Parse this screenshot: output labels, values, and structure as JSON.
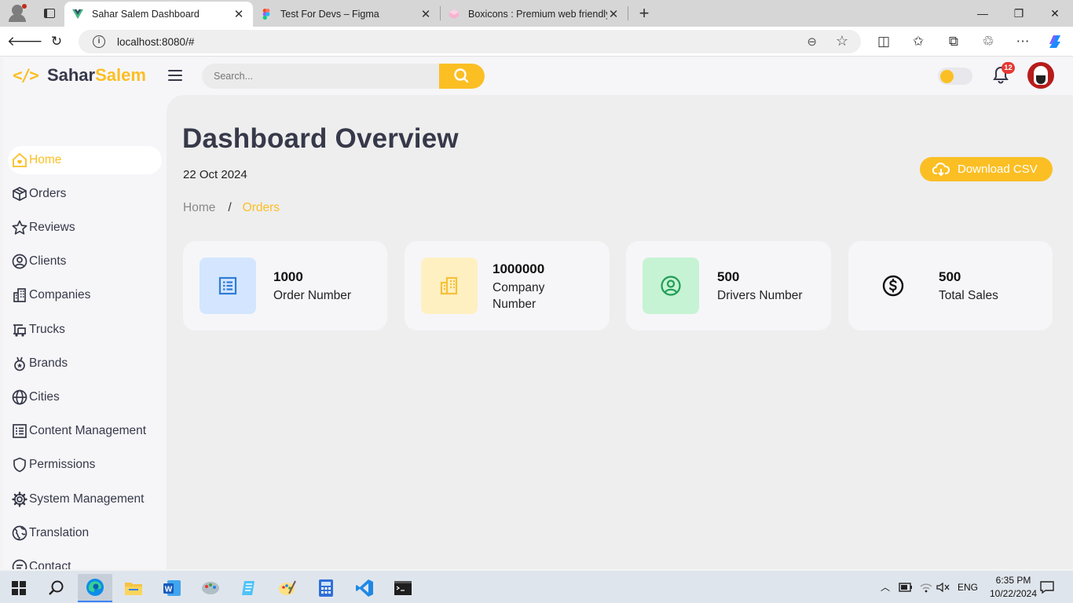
{
  "browser": {
    "tabs": [
      {
        "title": "Sahar Salem Dashboard",
        "active": true,
        "favicon": "vuejs-icon"
      },
      {
        "title": "Test For Devs – Figma",
        "active": false,
        "favicon": "figma-icon"
      },
      {
        "title": "Boxicons : Premium web friendly i",
        "active": false,
        "favicon": "boxicons-icon"
      }
    ],
    "url": "localhost:8080/#"
  },
  "header": {
    "logo_code": "</>",
    "logo_part1": "Sahar",
    "logo_part2": "Salem",
    "search_placeholder": "Search...",
    "notification_count": "12",
    "accent": "#fbbf24"
  },
  "sidebar": {
    "items": [
      {
        "label": "Home",
        "icon": "home-icon",
        "active": true
      },
      {
        "label": "Orders",
        "icon": "package-icon"
      },
      {
        "label": "Reviews",
        "icon": "star-icon"
      },
      {
        "label": "Clients",
        "icon": "user-circle-icon"
      },
      {
        "label": "Companies",
        "icon": "buildings-icon"
      },
      {
        "label": "Trucks",
        "icon": "truck-icon"
      },
      {
        "label": "Brands",
        "icon": "medal-icon"
      },
      {
        "label": "Cities",
        "icon": "globe-icon"
      },
      {
        "label": "Content Management",
        "icon": "list-icon"
      },
      {
        "label": "Permissions",
        "icon": "shield-icon"
      },
      {
        "label": "System Management",
        "icon": "gear-icon"
      },
      {
        "label": "Translation",
        "icon": "world-icon"
      },
      {
        "label": "Contact",
        "icon": "message-icon"
      }
    ]
  },
  "main": {
    "title": "Dashboard Overview",
    "date": "22 Oct 2024",
    "breadcrumb": {
      "home": "Home",
      "separator": "/",
      "current": "Orders"
    },
    "download_label": "Download CSV",
    "cards": [
      {
        "value": "1000",
        "label": "Order Number",
        "icon": "receipt-icon",
        "bg": "#d4e6ff",
        "fg": "#2e7bd6"
      },
      {
        "value": "1000000",
        "label": "Company Number",
        "icon": "buildings-icon",
        "bg": "#fff0c2",
        "fg": "#f5c13b"
      },
      {
        "value": "500",
        "label": "Drivers Number",
        "icon": "user-circle-icon",
        "bg": "#c6f3d3",
        "fg": "#1f9d55"
      },
      {
        "value": "500",
        "label": "Total Sales",
        "icon": "dollar-circle-icon",
        "bg": "#f6f6f9",
        "fg": "#111111"
      }
    ]
  },
  "taskbar": {
    "language": "ENG",
    "time": "6:35 PM",
    "date": "10/22/2024"
  }
}
